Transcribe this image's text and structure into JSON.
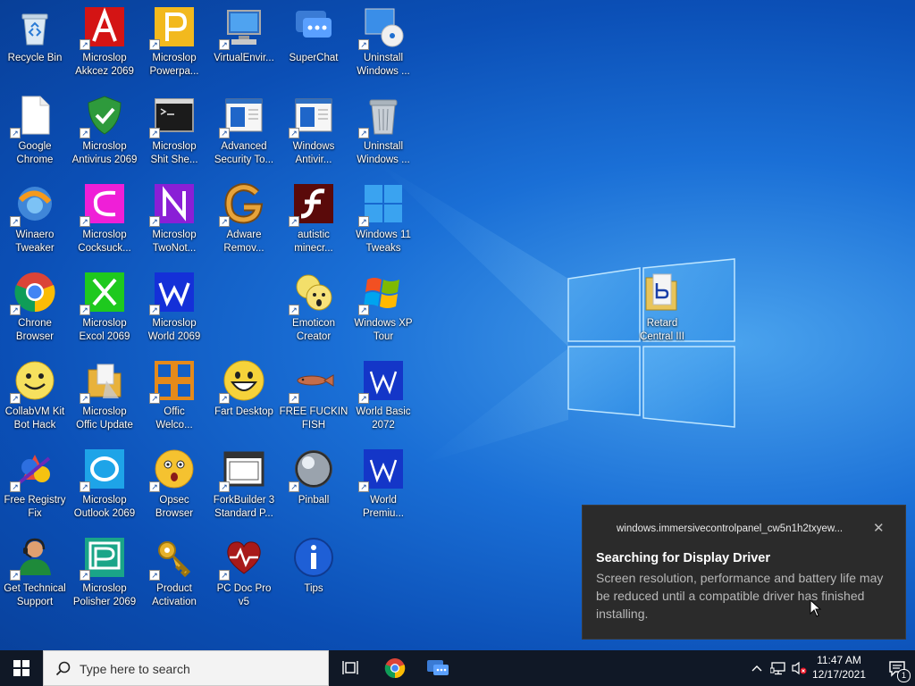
{
  "desktop": {
    "icons": [
      {
        "label": "Recycle Bin",
        "icon": "recycle-bin-icon",
        "shortcut": false
      },
      {
        "label": "Microslop\nAkkcez 2069",
        "icon": "access-icon",
        "shortcut": true
      },
      {
        "label": "Microslop\nPowerpa...",
        "icon": "powerpoint-icon",
        "shortcut": true
      },
      {
        "label": "VirtualEnvir...",
        "icon": "computer-icon",
        "shortcut": true
      },
      {
        "label": "SuperChat",
        "icon": "chat-icon",
        "shortcut": false
      },
      {
        "label": "Uninstall\nWindows ...",
        "icon": "uninstall-disc-icon",
        "shortcut": true
      },
      {
        "label": "Google\nChrome",
        "icon": "blank-document-icon",
        "shortcut": true
      },
      {
        "label": "Microslop\nAntivirus 2069",
        "icon": "shield-icon",
        "shortcut": true
      },
      {
        "label": "Microslop\nShit She...",
        "icon": "terminal-icon",
        "shortcut": true
      },
      {
        "label": "Advanced\nSecurity To...",
        "icon": "security-window-icon",
        "shortcut": true
      },
      {
        "label": "Windows\nAntivir...",
        "icon": "security-window-icon",
        "shortcut": true
      },
      {
        "label": "Uninstall\nWindows ...",
        "icon": "trash-can-icon",
        "shortcut": true
      },
      {
        "label": "Winaero\nTweaker",
        "icon": "tweaker-icon",
        "shortcut": true
      },
      {
        "label": "Microslop\nCocksuck...",
        "icon": "ms-c-icon",
        "shortcut": true
      },
      {
        "label": "Microslop\nTwoNot...",
        "icon": "ms-n-icon",
        "shortcut": true
      },
      {
        "label": "Adware\nRemov...",
        "icon": "g-icon",
        "shortcut": true
      },
      {
        "label": "autistic\nminecr...",
        "icon": "flash-icon",
        "shortcut": true
      },
      {
        "label": "Windows 11\nTweaks",
        "icon": "windows11-icon",
        "shortcut": true
      },
      {
        "label": "Chrone\nBrowser",
        "icon": "chrome-icon",
        "shortcut": true
      },
      {
        "label": "Microslop\nExcol 2069",
        "icon": "ms-x-icon",
        "shortcut": true
      },
      {
        "label": "Microslop\nWorld 2069",
        "icon": "ms-w-icon",
        "shortcut": true
      },
      {
        "label": "",
        "icon": "",
        "shortcut": false
      },
      {
        "label": "Emoticon\nCreator",
        "icon": "emoticon-icon",
        "shortcut": true
      },
      {
        "label": "Windows XP\nTour",
        "icon": "windows-xp-icon",
        "shortcut": true
      },
      {
        "label": "CollabVM Kit\nBot Hack",
        "icon": "smiley-icon",
        "shortcut": true
      },
      {
        "label": "Microslop\nOffic Update",
        "icon": "folder-update-icon",
        "shortcut": true
      },
      {
        "label": "Offic\nWelco...",
        "icon": "office-icon",
        "shortcut": true
      },
      {
        "label": "Fart Desktop",
        "icon": "grin-icon",
        "shortcut": true
      },
      {
        "label": "FREE FUCKIN\nFISH",
        "icon": "fish-icon",
        "shortcut": true
      },
      {
        "label": "World Basic\n2072",
        "icon": "w-blue-icon",
        "shortcut": true
      },
      {
        "label": "Free Registry\nFix",
        "icon": "registry-icon",
        "shortcut": true
      },
      {
        "label": "Microslop\nOutlook 2069",
        "icon": "outlook-icon",
        "shortcut": true
      },
      {
        "label": "Opsec\nBrowser",
        "icon": "shocked-face-icon",
        "shortcut": true
      },
      {
        "label": "ForkBuilder 3\nStandard P...",
        "icon": "window-frame-icon",
        "shortcut": true
      },
      {
        "label": "Pinball",
        "icon": "pinball-icon",
        "shortcut": true
      },
      {
        "label": "World\nPremiu...",
        "icon": "w-blue-icon",
        "shortcut": true
      },
      {
        "label": "Get Technical\nSupport",
        "icon": "support-person-icon",
        "shortcut": true
      },
      {
        "label": "Microslop\nPolisher 2069",
        "icon": "publisher-icon",
        "shortcut": true
      },
      {
        "label": "Product\nActivation",
        "icon": "key-icon",
        "shortcut": true
      },
      {
        "label": "PC Doc Pro\nv5",
        "icon": "heartbeat-icon",
        "shortcut": true
      },
      {
        "label": "Tips",
        "icon": "info-icon",
        "shortcut": false
      },
      {
        "label": "",
        "icon": "",
        "shortcut": false
      }
    ],
    "extra_icon": {
      "label": "Retard\nCentral III",
      "icon": "folder-icon"
    }
  },
  "notification": {
    "app": "windows.immersivecontrolpanel_cw5n1h2txyew...",
    "close": "✕",
    "title": "Searching for Display Driver",
    "body": "Screen resolution, performance and battery life may be reduced until a compatible driver has finished installing."
  },
  "taskbar": {
    "search_placeholder": "Type here to search",
    "time": "11:47 AM",
    "date": "12/17/2021",
    "notification_count": "1"
  }
}
